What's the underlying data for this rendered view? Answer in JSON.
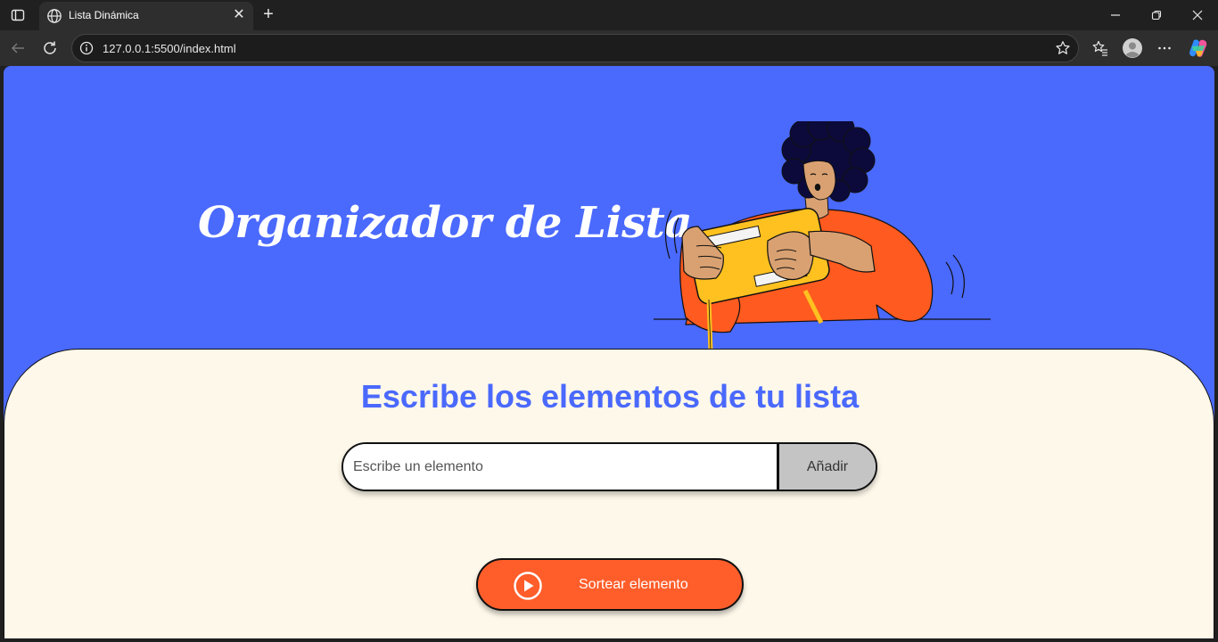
{
  "browser": {
    "tab_title": "Lista Dinámica",
    "url": "127.0.0.1:5500/index.html"
  },
  "page": {
    "hero_title": "Organizador de Lista",
    "section_heading": "Escribe los elementos de tu lista",
    "input_placeholder": "Escribe un elemento",
    "add_button_label": "Añadir",
    "draw_button_label": "Sortear elemento"
  },
  "colors": {
    "hero_background": "#4a69fd",
    "card_background": "#fef8ea",
    "heading": "#4a69fd",
    "draw_button": "#ff5d2a",
    "add_button": "#c4c4c4"
  },
  "icons": [
    "sidebar-icon",
    "globe-icon",
    "close-icon",
    "plus-icon",
    "minimize-icon",
    "restore-icon",
    "window-close-icon",
    "back-icon",
    "reload-icon",
    "info-icon",
    "star-icon",
    "favorites-icon",
    "profile-icon",
    "more-icon",
    "copilot-icon",
    "play-icon"
  ]
}
